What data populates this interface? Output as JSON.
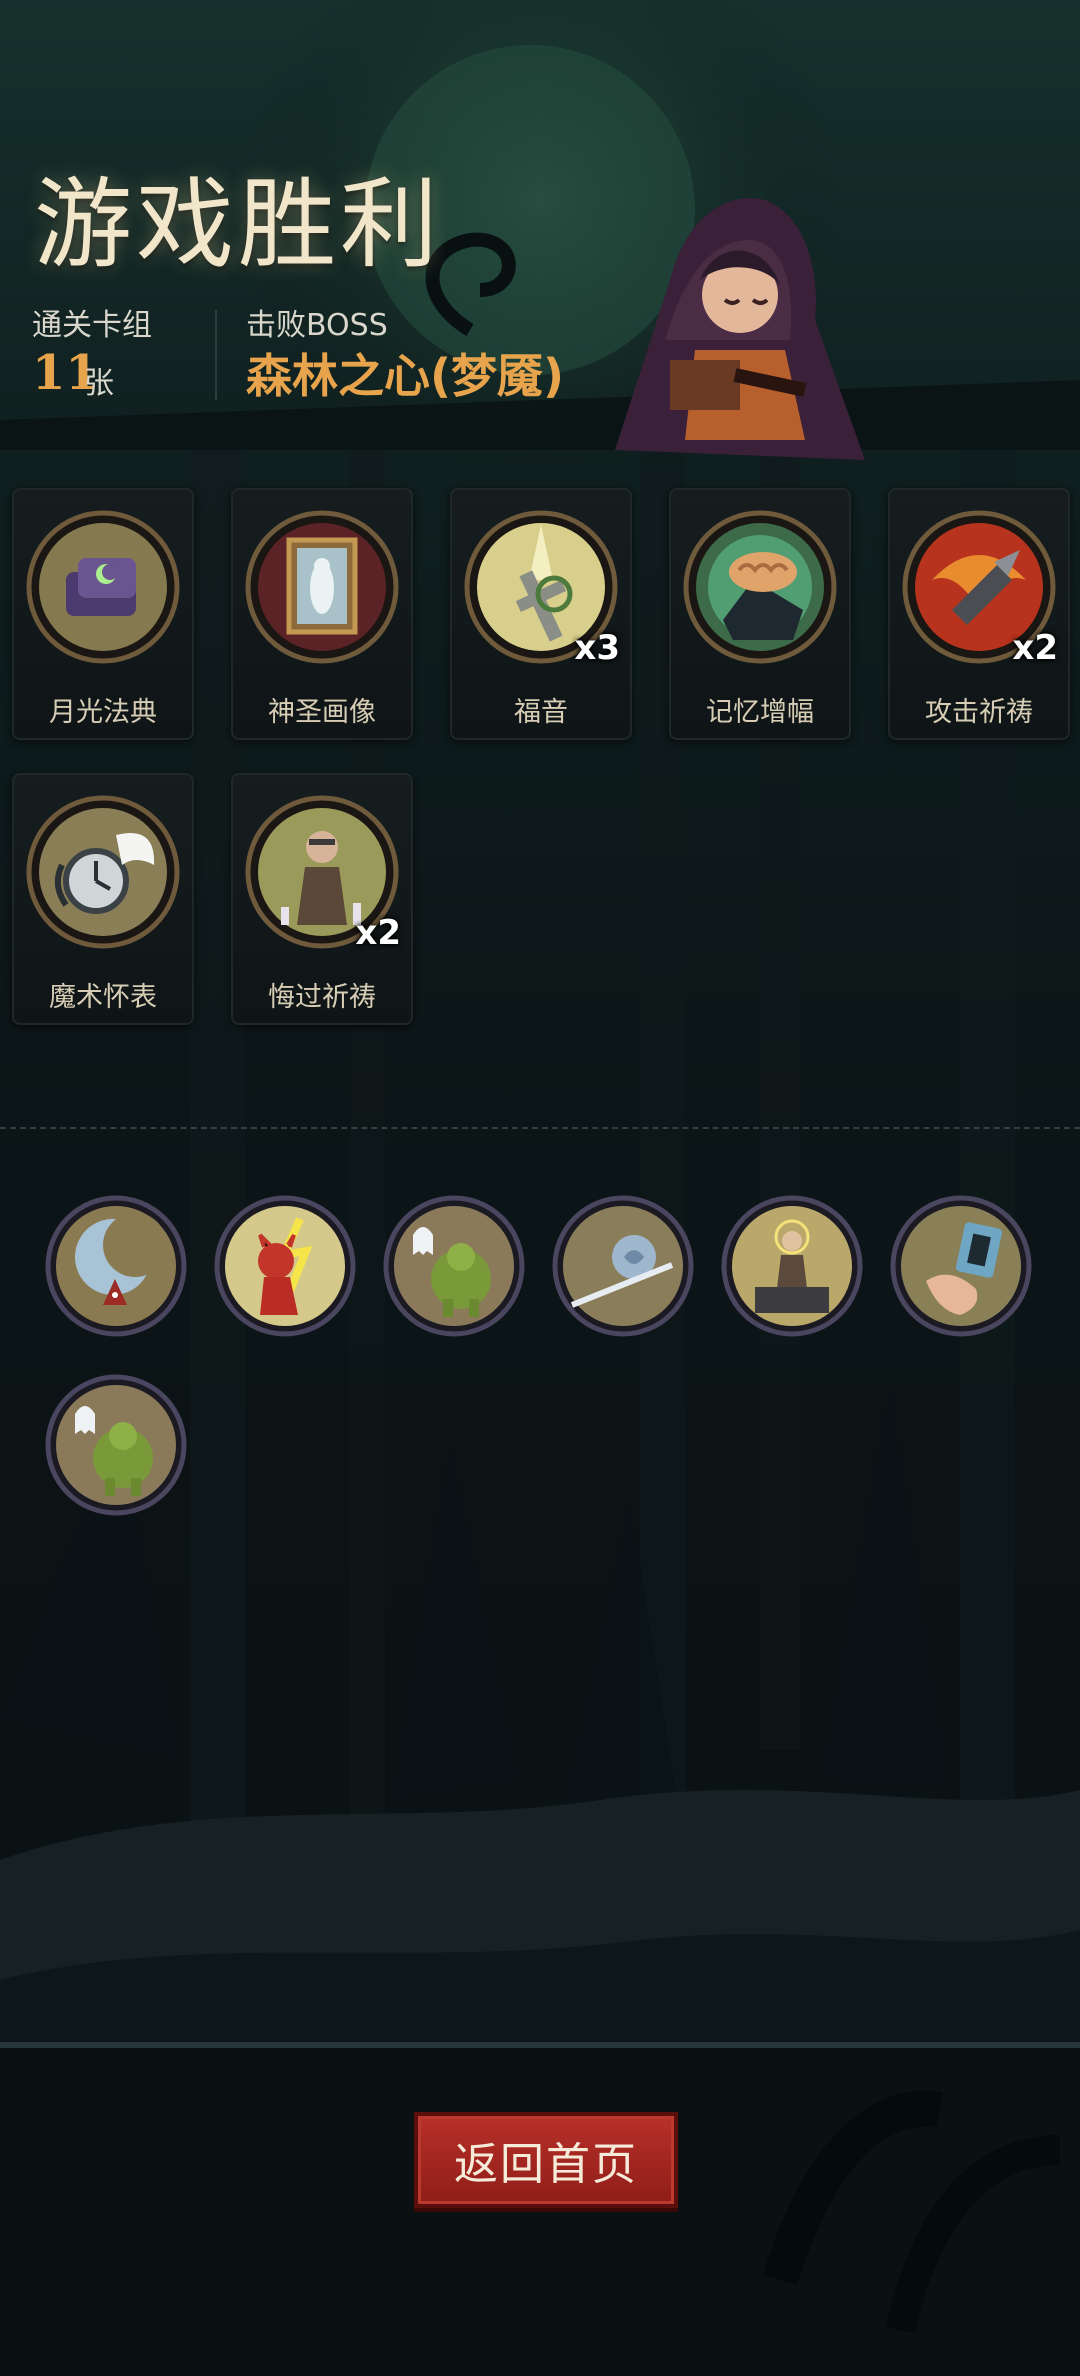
{
  "header": {
    "title": "游戏胜利",
    "deck_label": "通关卡组",
    "deck_count": "11",
    "deck_unit": "张",
    "boss_label": "击败BOSS",
    "boss_name": "森林之心(梦魇)"
  },
  "cards": [
    {
      "name": "月光法典",
      "icon": "moonlight-tome-icon",
      "multiplier": ""
    },
    {
      "name": "神圣画像",
      "icon": "holy-portrait-icon",
      "multiplier": ""
    },
    {
      "name": "福音",
      "icon": "gospel-icon",
      "multiplier": "x3"
    },
    {
      "name": "记忆增幅",
      "icon": "memory-boost-icon",
      "multiplier": ""
    },
    {
      "name": "攻击祈祷",
      "icon": "attack-prayer-icon",
      "multiplier": "x2"
    },
    {
      "name": "魔术怀表",
      "icon": "magic-pocket-watch-icon",
      "multiplier": ""
    },
    {
      "name": "悔过祈祷",
      "icon": "repentance-prayer-icon",
      "multiplier": "x2"
    }
  ],
  "relics": [
    {
      "icon": "crescent-moon-relic-icon"
    },
    {
      "icon": "red-demon-relic-icon"
    },
    {
      "icon": "green-ogre-ghost-relic-icon"
    },
    {
      "icon": "rose-blade-relic-icon"
    },
    {
      "icon": "saint-altar-relic-icon"
    },
    {
      "icon": "hand-card-relic-icon"
    },
    {
      "icon": "green-ogre-ghost-relic-icon"
    }
  ],
  "footer": {
    "return_label": "返回首页"
  },
  "colors": {
    "accent_gold": "#e7a44c",
    "button_red": "#a52822",
    "title_cream": "#f1e6c9"
  }
}
